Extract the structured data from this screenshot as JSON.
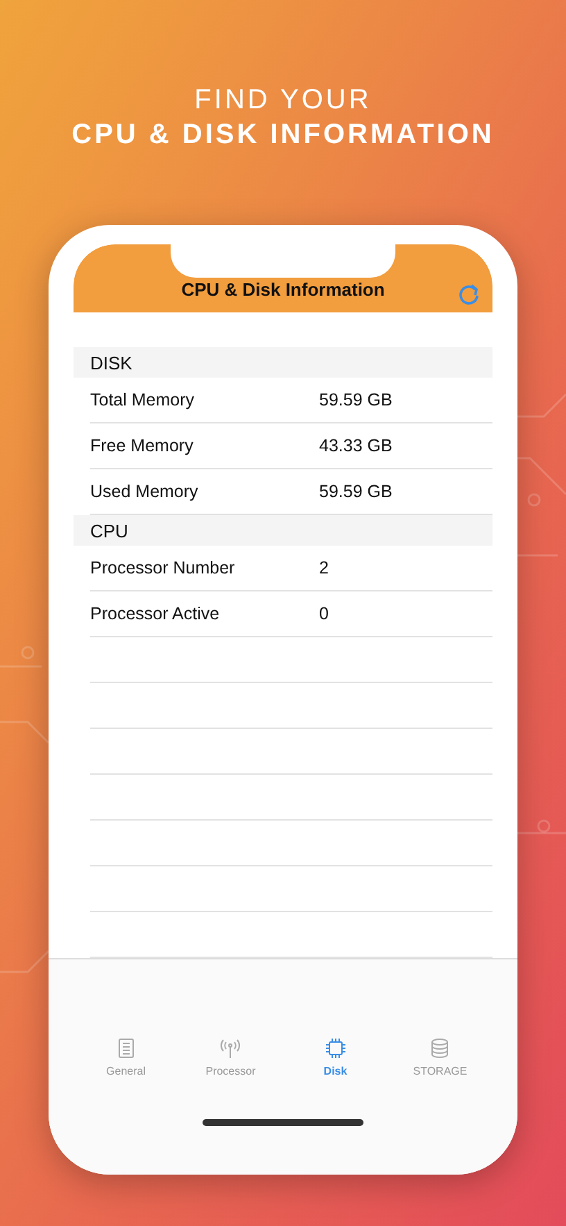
{
  "headline": {
    "line_1": "FIND YOUR",
    "line_2": "CPU & DISK INFORMATION"
  },
  "nav_bar": {
    "title": "CPU & Disk Information"
  },
  "sections": [
    {
      "title": "DISK",
      "rows": [
        {
          "label": "Total Memory",
          "value": "59.59 GB"
        },
        {
          "label": "Free Memory",
          "value": "43.33 GB"
        },
        {
          "label": "Used Memory",
          "value": "59.59 GB"
        }
      ]
    },
    {
      "title": "CPU",
      "rows": [
        {
          "label": "Processor Number",
          "value": "2"
        },
        {
          "label": "Processor Active",
          "value": "0"
        }
      ]
    }
  ],
  "tabs": [
    {
      "label": "General",
      "kind": "notebook",
      "selected": false
    },
    {
      "label": "Processor",
      "kind": "antenna",
      "selected": false
    },
    {
      "label": "Disk",
      "kind": "chip",
      "selected": true
    },
    {
      "label": "STORAGE",
      "kind": "database",
      "selected": false
    }
  ]
}
